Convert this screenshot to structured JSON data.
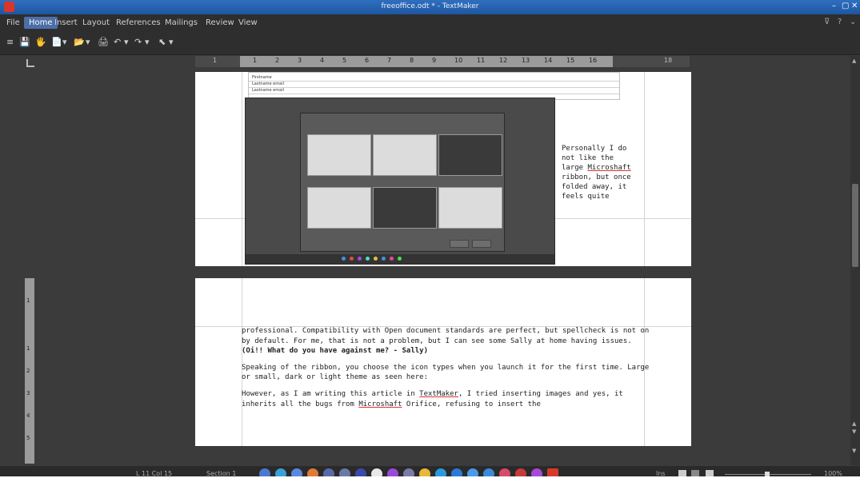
{
  "window": {
    "title": "freeoffice.odt * - TextMaker",
    "controls": [
      "–",
      "▢",
      "✕"
    ]
  },
  "menu": {
    "items": [
      "File",
      "Home",
      "Insert",
      "Layout",
      "References",
      "Mailings",
      "Review",
      "View"
    ],
    "active": "Home",
    "right_icons": [
      "⊽",
      "?",
      "⌄"
    ]
  },
  "quickbar": {
    "icons": [
      "≡",
      "💾",
      "🖐",
      "📄",
      "▾",
      "📂",
      "▾",
      "🖨",
      "↶",
      "▾",
      "↷",
      "▾",
      "⬉",
      "▾"
    ]
  },
  "ruler": {
    "marks": [
      "1",
      "1",
      "2",
      "3",
      "4",
      "5",
      "6",
      "7",
      "8",
      "9",
      "10",
      "11",
      "12",
      "13",
      "14",
      "15",
      "16",
      "18"
    ],
    "vmarks": [
      "1",
      "1",
      "2",
      "3",
      "4",
      "5"
    ]
  },
  "page1": {
    "sheet_rows": [
      "Firstname",
      "Lastname email",
      "Lastname email"
    ],
    "float_text": {
      "l1": "Personally I do",
      "l2": "not like the",
      "l3_pre": "large ",
      "l3_link": "Microshaft",
      "l4": "ribbon, but once",
      "l5": "folded away, it",
      "l6": "feels quite"
    }
  },
  "page2": {
    "p1_a": "professional. Compatibility with Open document standards are perfect, but spellcheck is not on by default. For me, that is not a problem, but I can see some Sally at home having issues. ",
    "p1_bold": "(Oi!! What do you have against me? - Sally)",
    "p2": "Speaking of the ribbon, you choose the icon types when you launch it for the first time. Large or small, dark or light theme as seen here:",
    "p3_a": "However, as I am writing this article in ",
    "p3_link1": "TextMaker",
    "p3_b": ", I tried inserting images and yes, it inherits all the bugs from ",
    "p3_link2": "Microshaft",
    "p3_c": " Orifice, refusing to insert the"
  },
  "status": {
    "position": "L 11 Col 15",
    "section": "Section 1",
    "mode": "Ins",
    "zoom": "100%"
  },
  "colors": {
    "titlebar": "#1e56a0",
    "active_tab": "#4d6fa8",
    "app_bg": "#3b3b3b",
    "logo": "#d9362a"
  }
}
